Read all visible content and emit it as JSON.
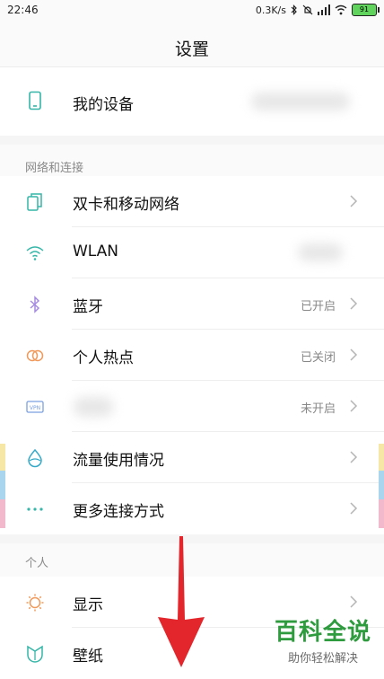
{
  "status": {
    "time": "22:46",
    "net_speed": "0.3K/s",
    "battery_level": "91"
  },
  "header": {
    "title": "设置"
  },
  "top_item": {
    "label": "我的设备"
  },
  "sections": [
    {
      "title": "网络和连接",
      "items": [
        {
          "label": "双卡和移动网络",
          "value": "",
          "icon": "dual-sim-icon"
        },
        {
          "label": "WLAN",
          "value": "",
          "icon": "wifi-icon"
        },
        {
          "label": "蓝牙",
          "value": "已开启",
          "icon": "bluetooth-icon"
        },
        {
          "label": "个人热点",
          "value": "已关闭",
          "icon": "hotspot-icon"
        },
        {
          "label": "",
          "value": "未开启",
          "icon": "vpn-icon"
        },
        {
          "label": "流量使用情况",
          "value": "",
          "icon": "data-usage-icon"
        },
        {
          "label": "更多连接方式",
          "value": "",
          "icon": "more-connections-icon"
        }
      ]
    },
    {
      "title": "个人",
      "items": [
        {
          "label": "显示",
          "value": "",
          "icon": "display-icon"
        },
        {
          "label": "壁纸",
          "value": "",
          "icon": "wallpaper-icon"
        }
      ]
    }
  ],
  "watermark": {
    "main": "百科全说",
    "sub": "助你轻松解决"
  },
  "colors": {
    "accent_teal": "#35b6a8",
    "arrow_red": "#e3262b",
    "watermark_green": "#2e9b3e"
  }
}
